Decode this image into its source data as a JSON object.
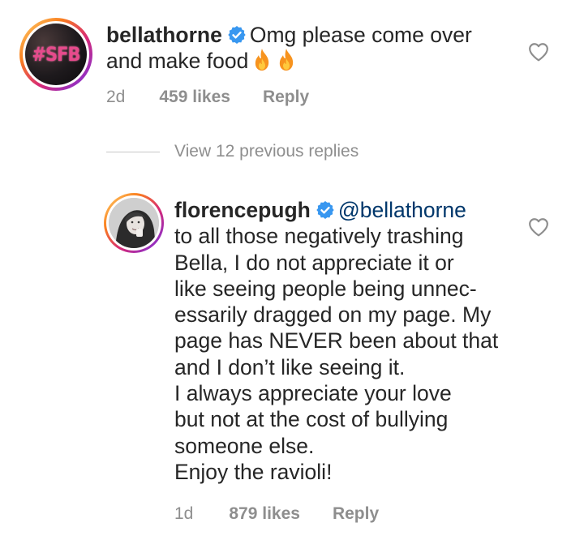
{
  "comments": [
    {
      "username": "bellathorne",
      "avatar_text": "#SFB",
      "text_line1": "Omg please come over",
      "text_line2": "and make food",
      "emojis": [
        "fire-emoji",
        "fire-emoji"
      ],
      "time": "2d",
      "likes": "459 likes",
      "reply_label": "Reply"
    },
    {
      "username": "florencepugh",
      "mention": "@bellathorne",
      "lines": [
        "to all those negatively trashing",
        "Bella, I do not appreciate it or",
        "like seeing people being unnec-",
        "essarily dragged on my page. My",
        "page has NEVER been about that",
        "and I don’t like seeing it.",
        "I always appreciate your love",
        "but not at the cost of bullying",
        "someone else.",
        "Enjoy the ravioli!"
      ],
      "time": "1d",
      "likes": "879 likes",
      "reply_label": "Reply"
    }
  ],
  "view_replies": "View 12 previous replies",
  "colors": {
    "text": "#262626",
    "secondary": "#8e8e8e",
    "mention": "#00376b",
    "verified": "#3897f0"
  }
}
